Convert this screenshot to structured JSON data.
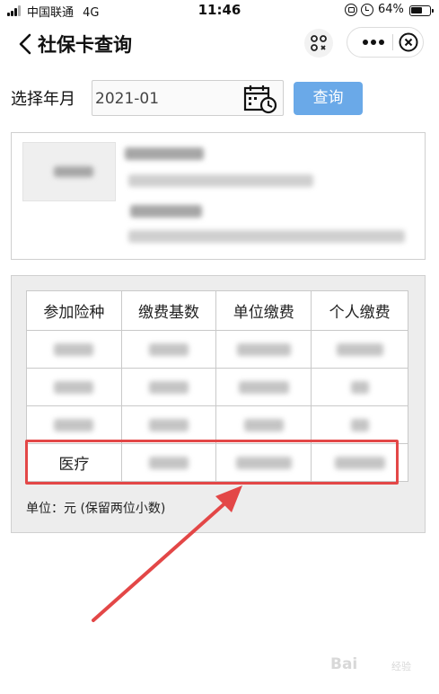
{
  "status_bar": {
    "carrier": "中国联通",
    "network": "4G",
    "time": "11:46",
    "battery_percent_label": "64%",
    "battery_level": 0.64
  },
  "nav": {
    "title": "社保卡查询",
    "back_icon": "chevron-left-icon",
    "scan_icon": "scan-icon",
    "more_icon": "more-dots-icon",
    "close_icon": "close-circle-icon"
  },
  "query": {
    "year_label": "选择年月",
    "year_value": "2021-01",
    "calendar_icon": "calendar-clock-icon",
    "button_label": "查询"
  },
  "table": {
    "headers": [
      "参加险种",
      "缴费基数",
      "单位缴费",
      "个人缴费"
    ],
    "highlighted_row_label": "医疗"
  },
  "footnote": "单位：元 (保留两位小数)",
  "colors": {
    "button": "#6aa9e8",
    "highlight": "#e34747",
    "panel_bg": "#ededed"
  },
  "watermark": {
    "brand": "Bai",
    "suffix": "经验"
  }
}
